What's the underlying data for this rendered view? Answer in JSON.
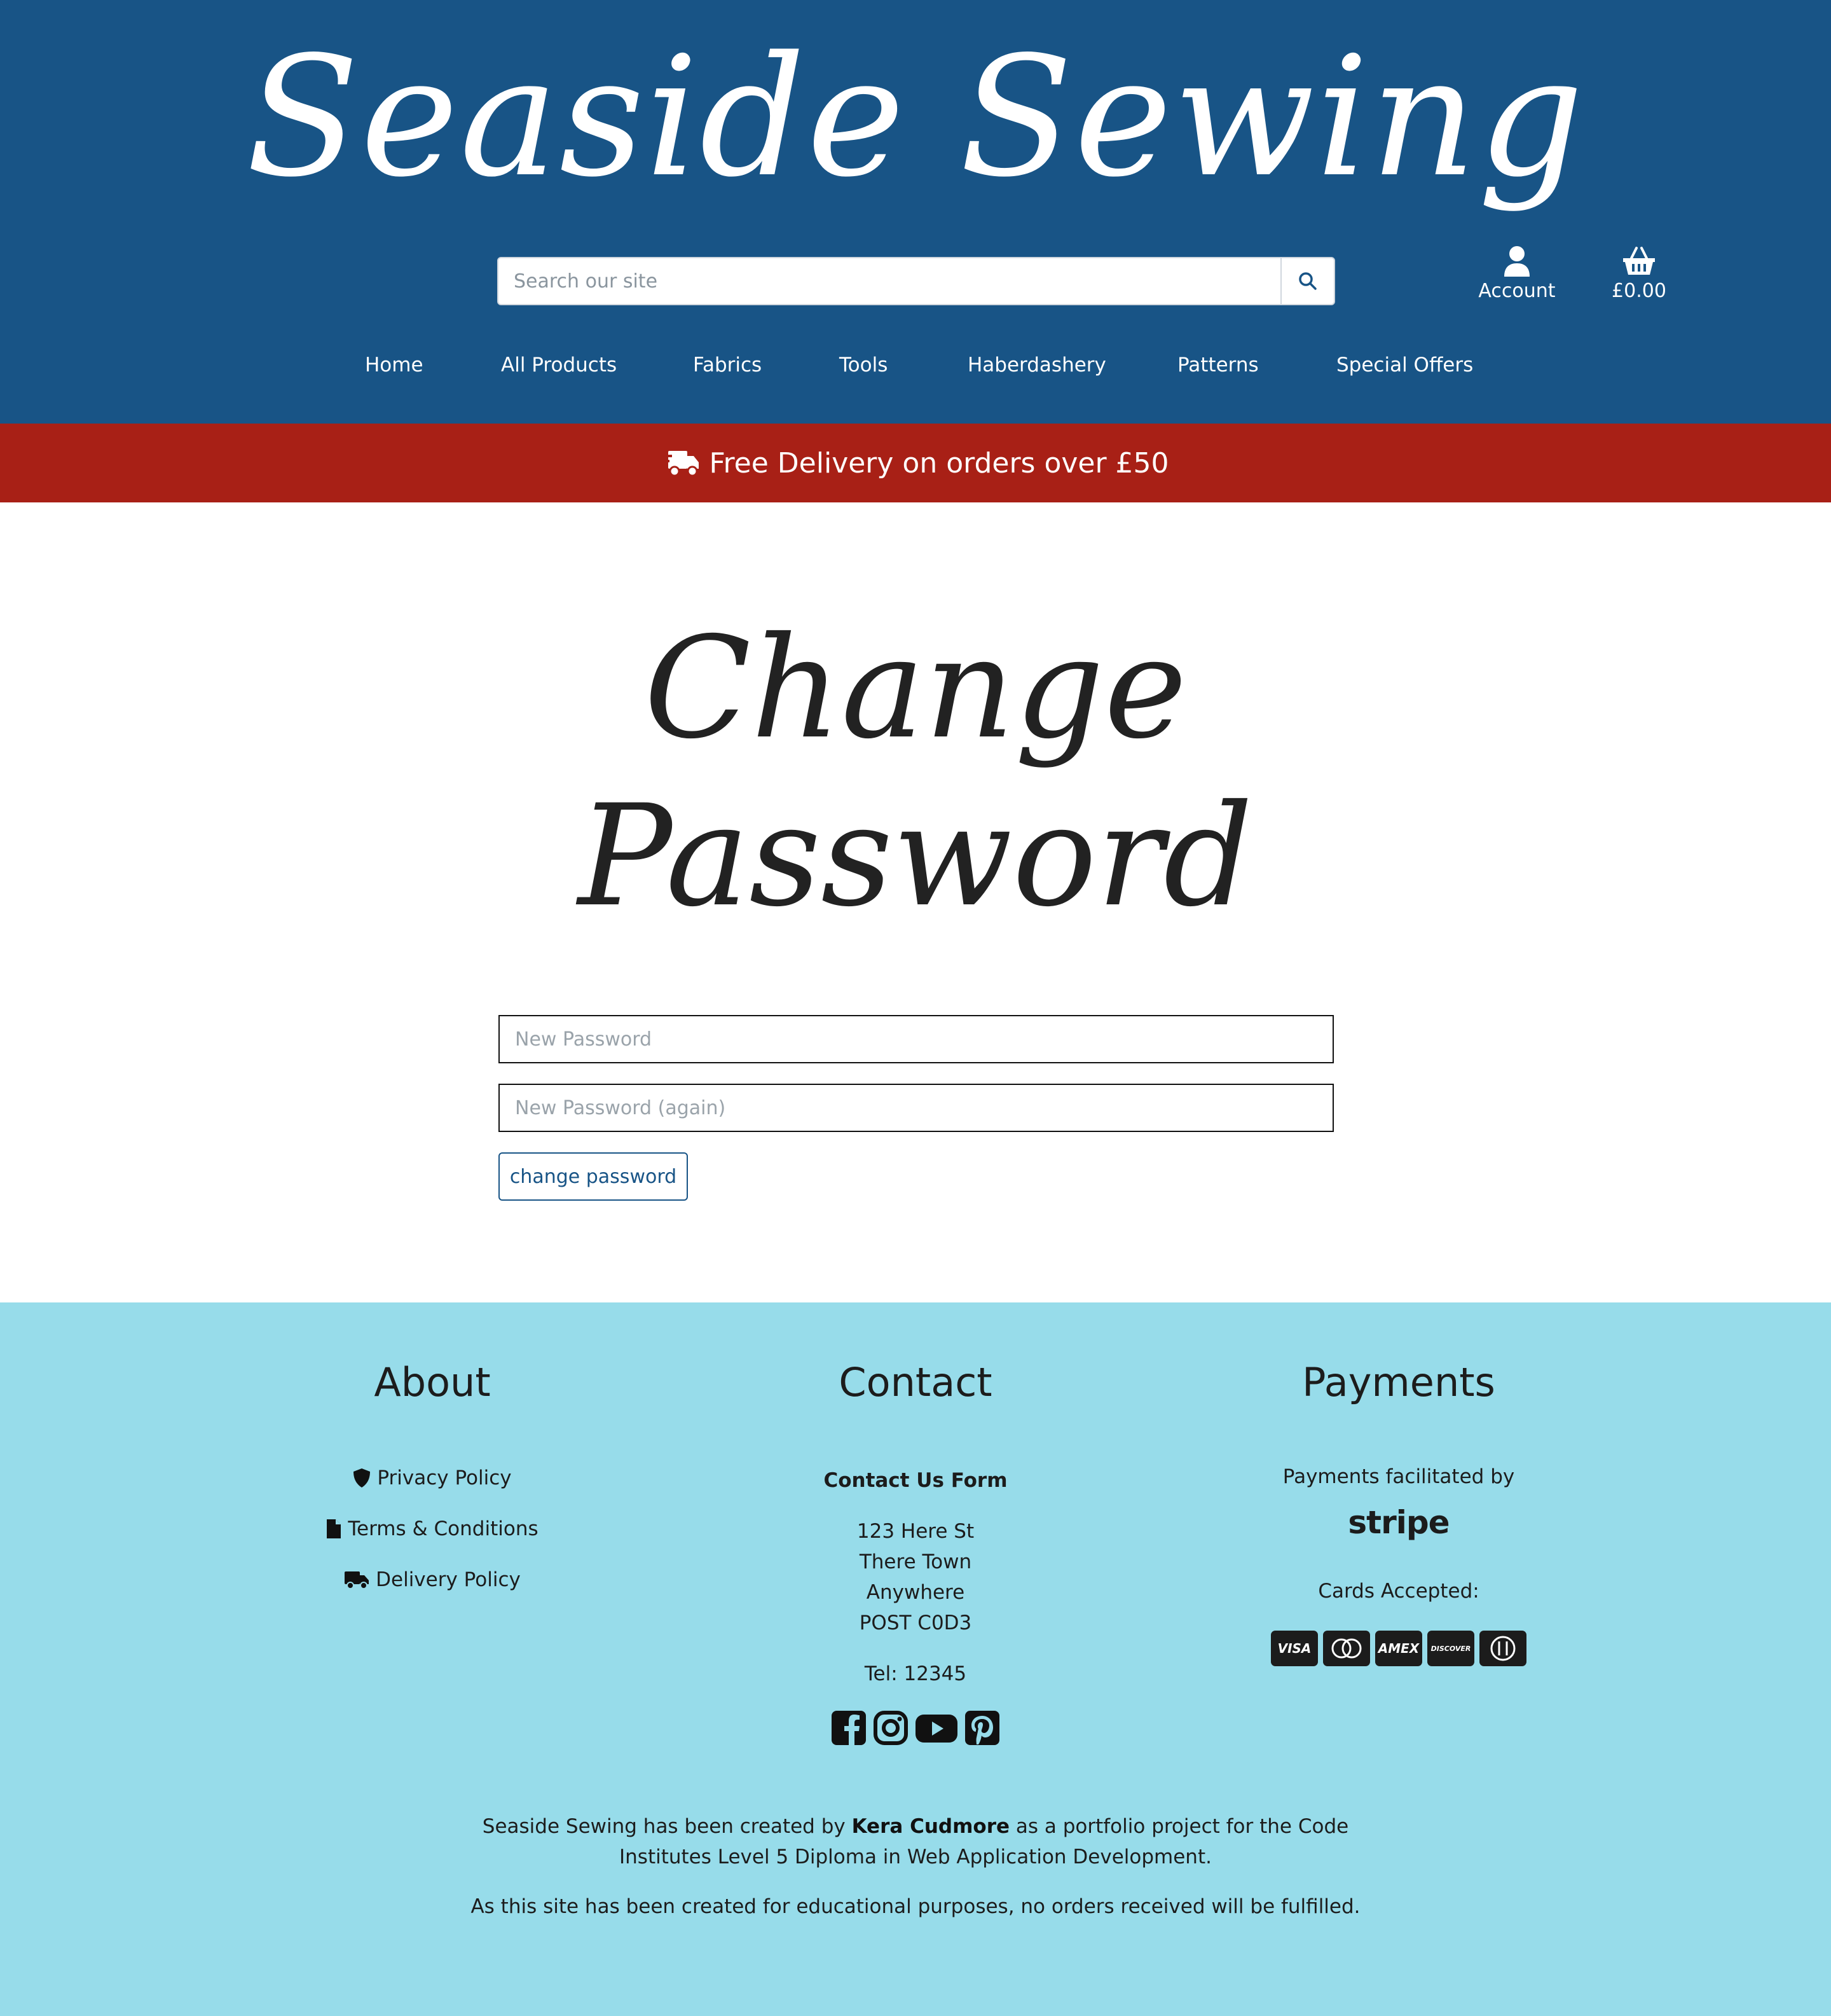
{
  "brand": {
    "name": "Seaside Sewing"
  },
  "search": {
    "placeholder": "Search our site"
  },
  "header": {
    "account_label": "Account",
    "basket_total": "£0.00"
  },
  "nav": {
    "items": [
      {
        "label": "Home"
      },
      {
        "label": "All Products"
      },
      {
        "label": "Fabrics"
      },
      {
        "label": "Tools"
      },
      {
        "label": "Haberdashery"
      },
      {
        "label": "Patterns"
      },
      {
        "label": "Special Offers"
      }
    ]
  },
  "banner": {
    "text": "Free Delivery on orders over £50"
  },
  "main": {
    "title_line1": "Change",
    "title_line2": "Password",
    "new_password_placeholder": "New Password",
    "new_password_again_placeholder": "New Password (again)",
    "submit_label": "change password"
  },
  "footer": {
    "about": {
      "heading": "About",
      "links": [
        {
          "label": "Privacy Policy",
          "icon": "shield-icon"
        },
        {
          "label": "Terms & Conditions",
          "icon": "file-icon"
        },
        {
          "label": "Delivery Policy",
          "icon": "truck-icon"
        }
      ]
    },
    "contact": {
      "heading": "Contact",
      "form_link": "Contact Us Form",
      "address": [
        "123 Here St",
        "There Town",
        "Anywhere",
        "POST C0D3"
      ],
      "tel": "Tel: 12345",
      "social": [
        "facebook-icon",
        "instagram-icon",
        "youtube-icon",
        "pinterest-icon"
      ]
    },
    "payments": {
      "heading": "Payments",
      "facilitated_text": "Payments facilitated by",
      "processor": "stripe",
      "cards_label": "Cards Accepted:",
      "cards": [
        "VISA",
        "mastercard",
        "AMEX",
        "DISCOVER",
        "Diners Club"
      ]
    },
    "credits": {
      "line1_before": "Seaside Sewing has been created by ",
      "author": "Kera Cudmore",
      "line1_after": " as a portfolio project for the Code Institutes Level 5 Diploma in Web Application Development.",
      "line2": "As this site has been created for educational purposes, no orders received will be fulfilled."
    }
  },
  "colors": {
    "header": "#185486",
    "banner": "#a82016",
    "footer": "#97dcea"
  }
}
